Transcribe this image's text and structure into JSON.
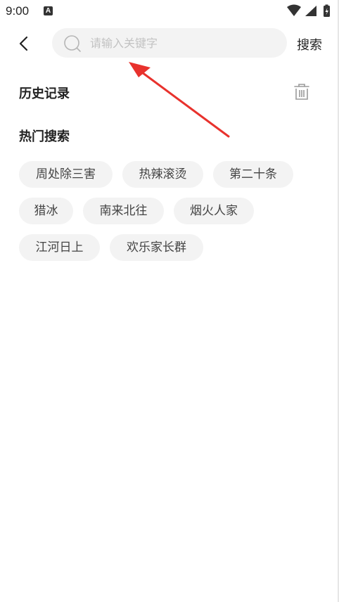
{
  "status_bar": {
    "time": "9:00",
    "notification_icon": "a-letter-icon",
    "icons": [
      "wifi-icon",
      "cell-signal-icon",
      "battery-icon"
    ]
  },
  "header": {
    "back_icon": "chevron-left-icon",
    "search_placeholder": "请输入关键字",
    "search_value": "",
    "search_icon": "search-icon",
    "search_button_label": "搜索"
  },
  "history": {
    "title": "历史记录",
    "clear_icon": "trash-icon"
  },
  "hot_search": {
    "title": "热门搜索",
    "items": [
      "周处除三害",
      "热辣滚烫",
      "第二十条",
      "猎冰",
      "南来北往",
      "烟火人家",
      "江河日上",
      "欢乐家长群"
    ]
  },
  "annotation": {
    "icon": "red-arrow-icon",
    "color": "#e8322d"
  },
  "colors": {
    "background": "#ffffff",
    "chip_background": "#f3f3f3",
    "text_primary": "#222222",
    "placeholder": "#c2c2c2"
  }
}
